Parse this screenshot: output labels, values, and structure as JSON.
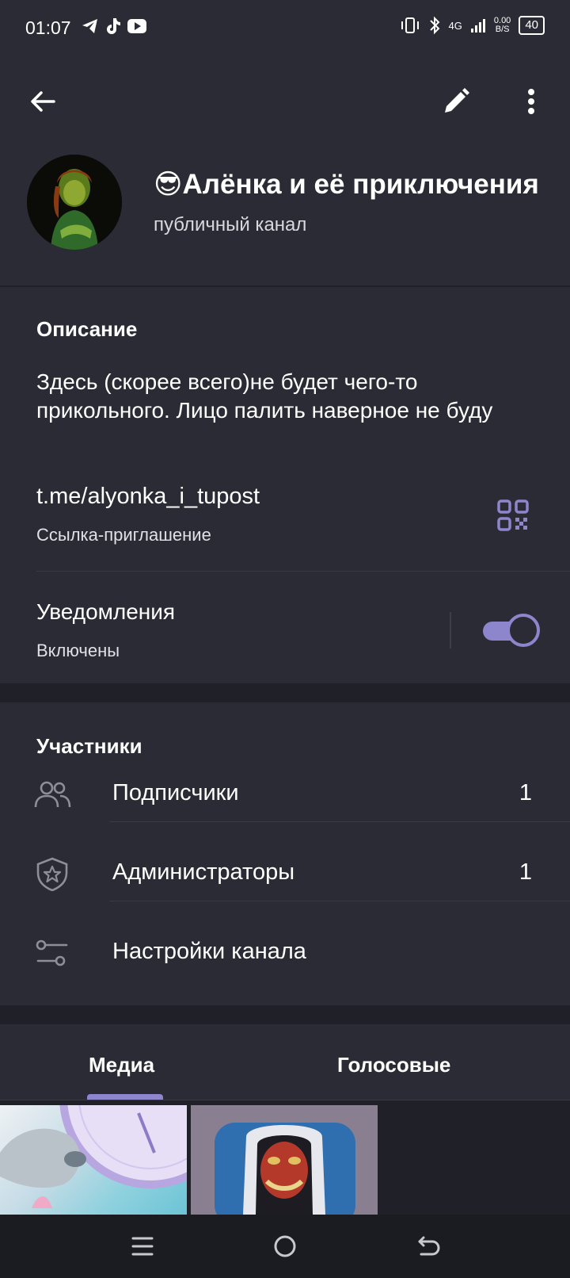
{
  "status_bar": {
    "time": "01:07",
    "network": "4G",
    "speed_value": "0.00",
    "speed_unit": "B/S",
    "battery": "40"
  },
  "header": {
    "channel_name": "😎Алёнка и её приключения",
    "channel_type": "публичный канал"
  },
  "info": {
    "description_title": "Описание",
    "description_text": "Здесь (скорее всего)не будет чего-то прикольного. Лицо палить наверное не буду",
    "link": "t.me/alyonka_i_tupost",
    "link_label": "Ссылка-приглашение",
    "notifications_title": "Уведомления",
    "notifications_status": "Включены",
    "notifications_enabled": true
  },
  "members": {
    "title": "Участники",
    "rows": [
      {
        "label": "Подписчики",
        "count": "1",
        "icon": "people-icon"
      },
      {
        "label": "Администраторы",
        "count": "1",
        "icon": "shield-star-icon"
      },
      {
        "label": "Настройки канала",
        "count": "",
        "icon": "sliders-icon"
      }
    ]
  },
  "tabs": [
    {
      "label": "Медиа",
      "active": true
    },
    {
      "label": "Голосовые",
      "active": false
    }
  ],
  "colors": {
    "accent": "#8d86cd",
    "card_bg": "#2b2b35",
    "page_bg": "#202029"
  }
}
